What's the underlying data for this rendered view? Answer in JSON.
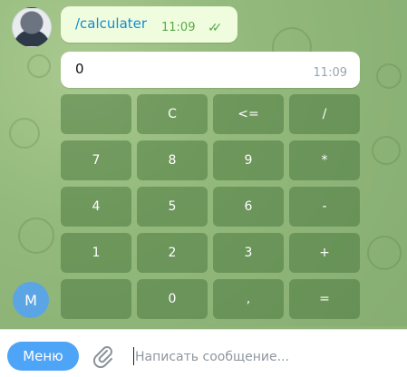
{
  "chat": {
    "command_message": {
      "text": "/calculater",
      "time": "11:09"
    },
    "display_message": {
      "value": "0",
      "time": "11:09"
    }
  },
  "keypad": [
    [
      "",
      "C",
      "<=",
      "/"
    ],
    [
      "7",
      "8",
      "9",
      "*"
    ],
    [
      "4",
      "5",
      "6",
      "-"
    ],
    [
      "1",
      "2",
      "3",
      "+"
    ],
    [
      "",
      "0",
      ",",
      "="
    ]
  ],
  "bot_avatar": {
    "letter": "M"
  },
  "composer": {
    "menu_label": "Меню",
    "placeholder": "Написать сообщение..."
  },
  "colors": {
    "accent": "#4ea4f6",
    "outgoing_bubble": "#effdde",
    "check": "#5aa74b"
  }
}
